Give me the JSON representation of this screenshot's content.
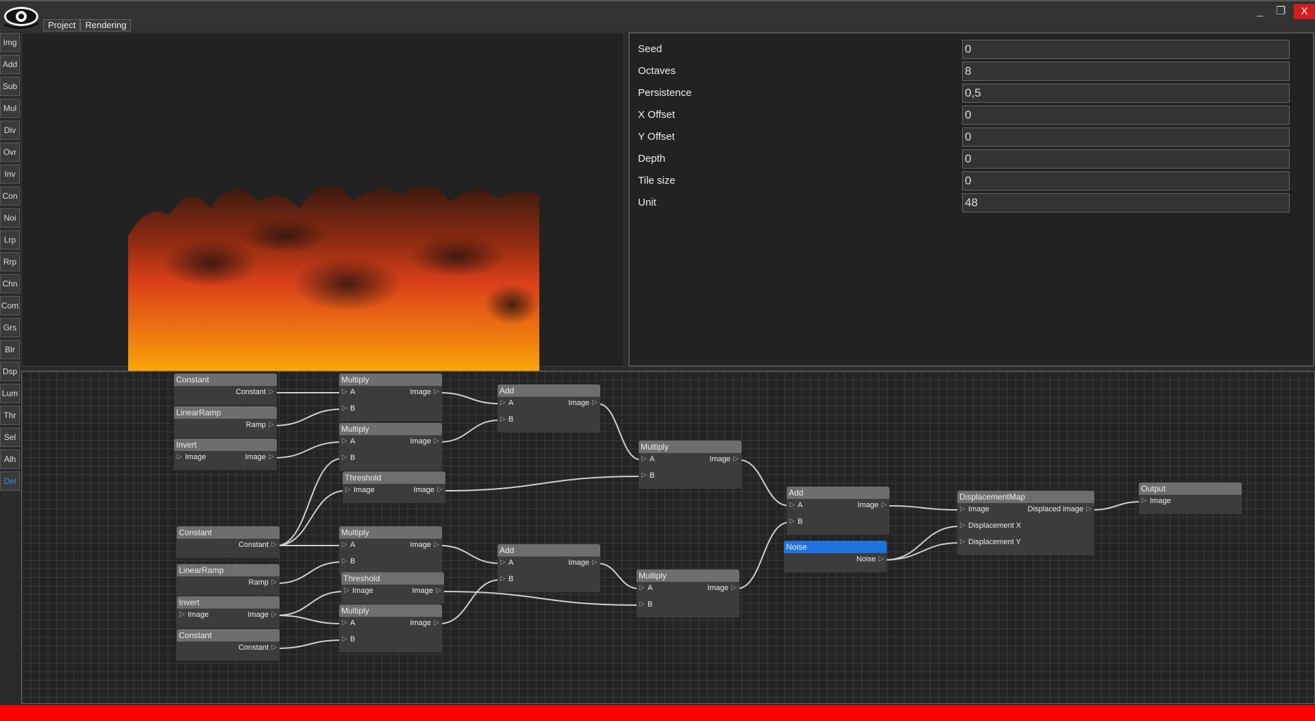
{
  "menu": [
    "Project",
    "Rendering"
  ],
  "window": {
    "minimize": "_",
    "maximize": "❐",
    "close": "X"
  },
  "toolbar": [
    "Img",
    "Add",
    "Sub",
    "Mul",
    "Div",
    "Ovr",
    "Inv",
    "Con",
    "Noi",
    "Lrp",
    "Rrp",
    "Chn",
    "Com",
    "Grs",
    "Blr",
    "Dsp",
    "Lum",
    "Thr",
    "Sel",
    "Alh",
    "Del"
  ],
  "toolbar_active": "Del",
  "properties": [
    {
      "label": "Seed",
      "value": "0"
    },
    {
      "label": "Octaves",
      "value": "8"
    },
    {
      "label": "Persistence",
      "value": "0,5"
    },
    {
      "label": "X Offset",
      "value": "0"
    },
    {
      "label": "Y Offset",
      "value": "0"
    },
    {
      "label": "Depth",
      "value": "0"
    },
    {
      "label": "Tile size",
      "value": "0"
    },
    {
      "label": "Unit",
      "value": "48"
    }
  ],
  "nodes": {
    "constant1": {
      "title": "Constant",
      "outputs": [
        "Constant"
      ]
    },
    "linearramp1": {
      "title": "LinearRamp",
      "outputs": [
        "Ramp"
      ]
    },
    "invert1": {
      "title": "Invert",
      "inputs": [
        "Image"
      ],
      "outputs": [
        "Image"
      ]
    },
    "multiply1": {
      "title": "Multiply",
      "inputs": [
        "A",
        "B"
      ],
      "outputs": [
        "Image"
      ]
    },
    "multiply2": {
      "title": "Multiply",
      "inputs": [
        "A",
        "B"
      ],
      "outputs": [
        "Image"
      ]
    },
    "threshold1": {
      "title": "Threshold",
      "inputs": [
        "Image"
      ],
      "outputs": [
        "Image"
      ]
    },
    "add1": {
      "title": "Add",
      "inputs": [
        "A",
        "B"
      ],
      "outputs": [
        "Image"
      ]
    },
    "multiply3": {
      "title": "Multiply",
      "inputs": [
        "A",
        "B"
      ],
      "outputs": [
        "Image"
      ]
    },
    "constant2": {
      "title": "Constant",
      "outputs": [
        "Constant"
      ]
    },
    "linearramp2": {
      "title": "LinearRamp",
      "outputs": [
        "Ramp"
      ]
    },
    "invert2": {
      "title": "Invert",
      "inputs": [
        "Image"
      ],
      "outputs": [
        "Image"
      ]
    },
    "constant3": {
      "title": "Constant",
      "outputs": [
        "Constant"
      ]
    },
    "multiply4": {
      "title": "Multiply",
      "inputs": [
        "A",
        "B"
      ],
      "outputs": [
        "Image"
      ]
    },
    "threshold2": {
      "title": "Threshold",
      "inputs": [
        "Image"
      ],
      "outputs": [
        "Image"
      ]
    },
    "multiply5": {
      "title": "Multiply",
      "inputs": [
        "A",
        "B"
      ],
      "outputs": [
        "Image"
      ]
    },
    "add2": {
      "title": "Add",
      "inputs": [
        "A",
        "B"
      ],
      "outputs": [
        "Image"
      ]
    },
    "multiply6": {
      "title": "Multiply",
      "inputs": [
        "A",
        "B"
      ],
      "outputs": [
        "Image"
      ]
    },
    "add3": {
      "title": "Add",
      "inputs": [
        "A",
        "B"
      ],
      "outputs": [
        "Image"
      ]
    },
    "noise": {
      "title": "Noise",
      "outputs": [
        "Noise"
      ]
    },
    "displacement": {
      "title": "DisplacementMap",
      "inputs": [
        "Image",
        "Displacement X",
        "Displacement Y"
      ],
      "outputs": [
        "Displaced image"
      ]
    },
    "output": {
      "title": "Output",
      "inputs": [
        "Image"
      ]
    }
  },
  "colors": {
    "selected_node": "#1f73e0",
    "close_button": "#d31d1d",
    "status_bar": "#ff0000",
    "active_tool": "#3a8ee6"
  }
}
